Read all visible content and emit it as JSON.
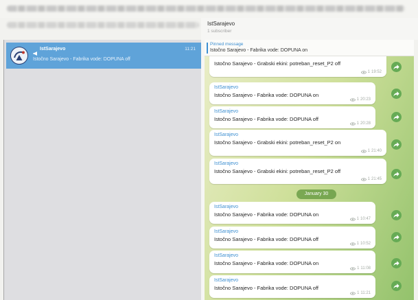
{
  "colors": {
    "accent": "#5fa3d9",
    "sender_name": "#3d8fd1",
    "share_button": "#66ab55",
    "date_pill": "rgba(95,150,60,0.75)",
    "chat_bg_start": "#e9edc6",
    "chat_bg_end": "#93c26c"
  },
  "icons": {
    "avatar": "channel-logo-icon",
    "channel_type": "megaphone-icon",
    "views": "eye-icon",
    "share": "share-arrow-icon"
  },
  "sidebar": {
    "chats": [
      {
        "name": "IstSarajevo",
        "preview": "Istočno Sarajevo - Fabrika vode: DOPUNA off",
        "time": "11:21",
        "selected": true
      }
    ]
  },
  "chat": {
    "title": "IstSarajevo",
    "subtitle": "1 subscriber",
    "pinned": {
      "label": "Pinned message",
      "text": "Istočno Sarajevo - Fabrika vode: DOPUNA on"
    },
    "messages_before": [
      {
        "text": "Istočno Sarajevo - Grabski ekini: potreban_reset_P2 off",
        "views": "1",
        "time": "19:52"
      },
      {
        "sender": "IstSarajevo",
        "text": "Istočno Sarajevo - Fabrika vode: DOPUNA on",
        "views": "1",
        "time": "20:23"
      },
      {
        "sender": "IstSarajevo",
        "text": "Istočno Sarajevo - Fabrika vode: DOPUNA off",
        "views": "1",
        "time": "20:28"
      },
      {
        "sender": "IstSarajevo",
        "text": "Istočno Sarajevo - Grabski ekini: potreban_reset_P2 on",
        "views": "1",
        "time": "21:40"
      },
      {
        "sender": "IstSarajevo",
        "text": "Istočno Sarajevo - Grabski ekini: potreban_reset_P2 off",
        "views": "1",
        "time": "21:45"
      }
    ],
    "date_separator": "January 30",
    "messages_after": [
      {
        "sender": "IstSarajevo",
        "text": "Istočno Sarajevo - Fabrika vode: DOPUNA on",
        "views": "1",
        "time": "10:47"
      },
      {
        "sender": "IstSarajevo",
        "text": "Istočno Sarajevo - Fabrika vode: DOPUNA off",
        "views": "1",
        "time": "10:52"
      },
      {
        "sender": "IstSarajevo",
        "text": "Istočno Sarajevo - Fabrika vode: DOPUNA on",
        "views": "1",
        "time": "11:08"
      },
      {
        "sender": "IstSarajevo",
        "text": "Istočno Sarajevo - Fabrika vode: DOPUNA off",
        "views": "1",
        "time": "11:21"
      }
    ]
  }
}
